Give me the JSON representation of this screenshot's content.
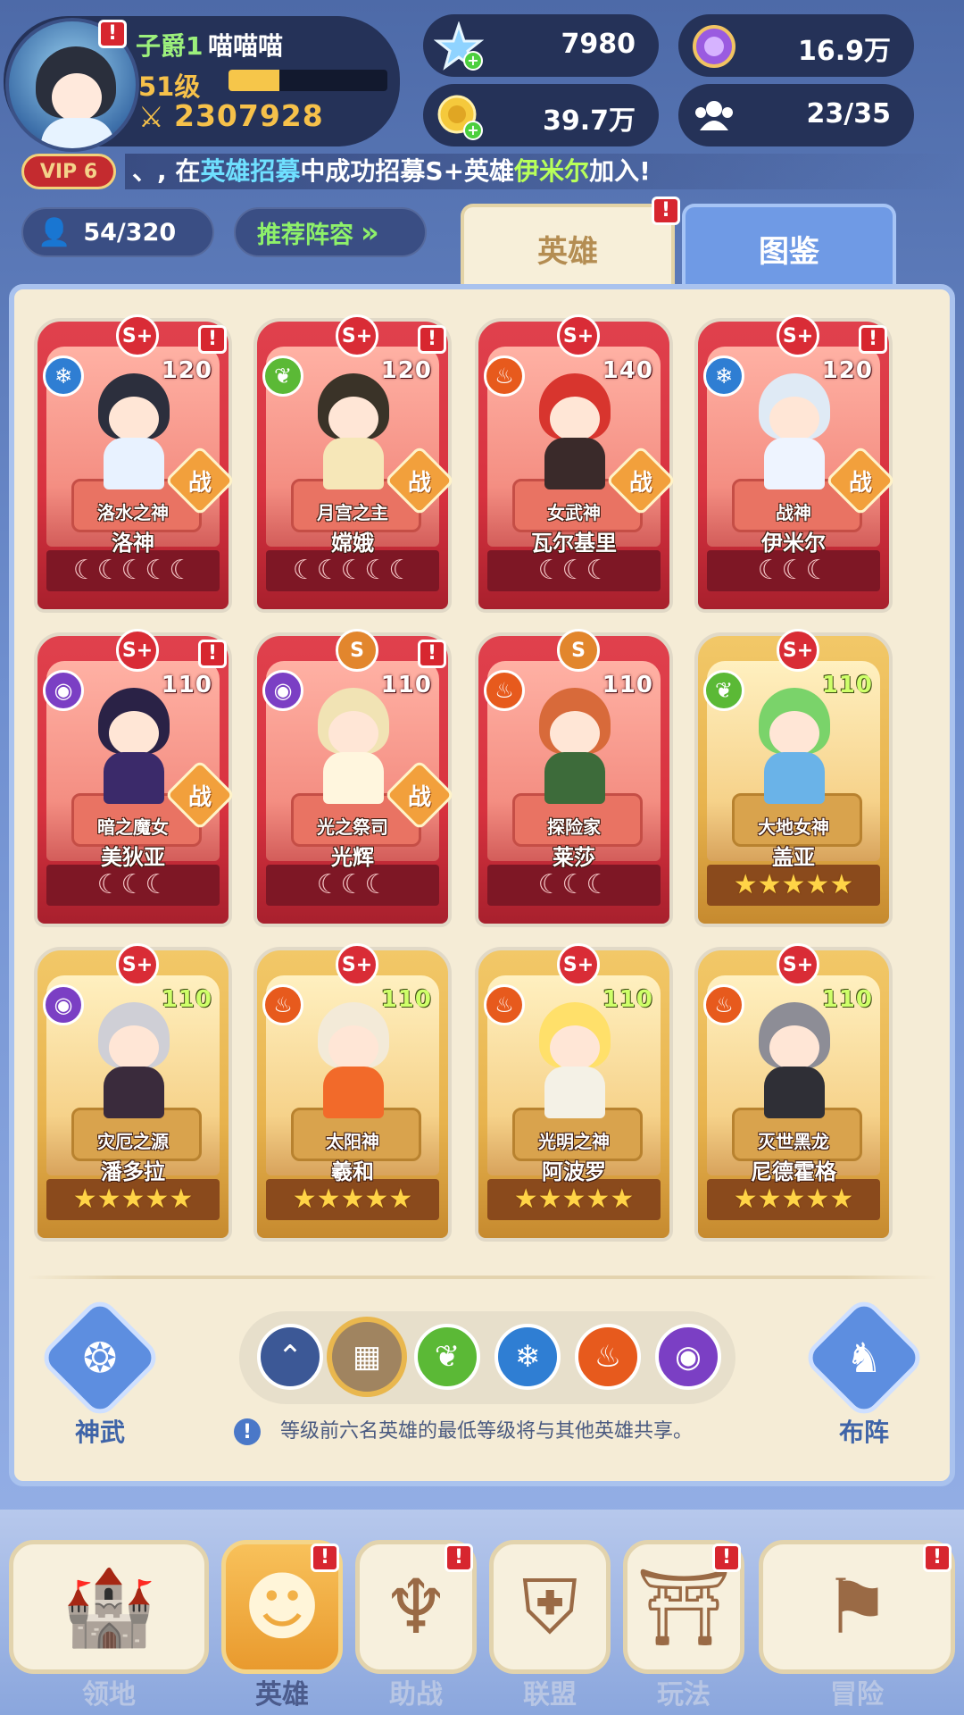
{
  "player": {
    "rank": "子爵1",
    "name": "喵喵喵",
    "level": "51级",
    "exp_fraction": 0.32,
    "power": "2307928"
  },
  "resources": {
    "diamond": "7980",
    "purple_gem": "16.9万",
    "gold": "39.7万",
    "members": "23/35"
  },
  "news": {
    "vip": "VIP 6",
    "prefix": "、, 在",
    "event": "英雄招募",
    "middle": "中成功招募S+英雄",
    "hero": "伊米尔",
    "suffix": "加入!"
  },
  "controls": {
    "hero_count": "54/320",
    "recommend": "推荐阵容"
  },
  "tabs": {
    "heroes": "英雄",
    "atlas": "图鉴"
  },
  "heroes": [
    {
      "grade": "S+",
      "level": "120",
      "element": "ice",
      "title": "洛水之神",
      "name": "洛神",
      "rating": "☾☾☾☾☾",
      "battle": "战",
      "alert": true
    },
    {
      "grade": "S+",
      "level": "120",
      "element": "nature",
      "title": "月宫之主",
      "name": "嫦娥",
      "rating": "☾☾☾☾☾",
      "battle": "战",
      "alert": true
    },
    {
      "grade": "S+",
      "level": "140",
      "element": "fire",
      "title": "女武神",
      "name": "瓦尔基里",
      "rating": "☾☾☾",
      "battle": "战",
      "alert": false
    },
    {
      "grade": "S+",
      "level": "120",
      "element": "ice",
      "title": "战神",
      "name": "伊米尔",
      "rating": "☾☾☾",
      "battle": "战",
      "alert": true
    },
    {
      "grade": "S+",
      "level": "110",
      "element": "dark",
      "title": "暗之魔女",
      "name": "美狄亚",
      "rating": "☾☾☾",
      "battle": "战",
      "alert": true
    },
    {
      "grade": "S",
      "level": "110",
      "element": "dark",
      "title": "光之祭司",
      "name": "光辉",
      "rating": "☾☾☾",
      "battle": "战",
      "alert": true
    },
    {
      "grade": "S",
      "level": "110",
      "element": "fire",
      "title": "探险家",
      "name": "莱莎",
      "rating": "☾☾☾",
      "battle": "",
      "alert": false
    },
    {
      "grade": "S+",
      "level": "110",
      "element": "nature",
      "title": "大地女神",
      "name": "盖亚",
      "rating": "★★★★★",
      "battle": "",
      "alert": false
    },
    {
      "grade": "S+",
      "level": "110",
      "element": "dark",
      "title": "灾厄之源",
      "name": "潘多拉",
      "rating": "★★★★★",
      "battle": "",
      "alert": false
    },
    {
      "grade": "S+",
      "level": "110",
      "element": "fire",
      "title": "太阳神",
      "name": "羲和",
      "rating": "★★★★★",
      "battle": "",
      "alert": false
    },
    {
      "grade": "S+",
      "level": "110",
      "element": "fire",
      "title": "光明之神",
      "name": "阿波罗",
      "rating": "★★★★★",
      "battle": "",
      "alert": false
    },
    {
      "grade": "S+",
      "level": "110",
      "element": "fire",
      "title": "灭世黑龙",
      "name": "尼德霍格",
      "rating": "★★★★★",
      "battle": "",
      "alert": false
    }
  ],
  "bottom": {
    "divine_weapon": "神武",
    "formation": "布阵",
    "hint": "等级前六名英雄的最低等级将与其他英雄共享。"
  },
  "nav": [
    {
      "label": "领地",
      "icon": "castle-icon",
      "alert": false
    },
    {
      "label": "英雄",
      "icon": "hero-icon",
      "alert": true
    },
    {
      "label": "助战",
      "icon": "support-icon",
      "alert": true
    },
    {
      "label": "联盟",
      "icon": "alliance-icon",
      "alert": false
    },
    {
      "label": "玩法",
      "icon": "gameplay-icon",
      "alert": true
    },
    {
      "label": "冒险",
      "icon": "adventure-flag-icon",
      "alert": true
    }
  ],
  "colors": {
    "red_card": "#d8323f",
    "gold_card": "#e7b24c",
    "accent_gold": "#f6c14a",
    "panel": "#f5ecd6"
  }
}
